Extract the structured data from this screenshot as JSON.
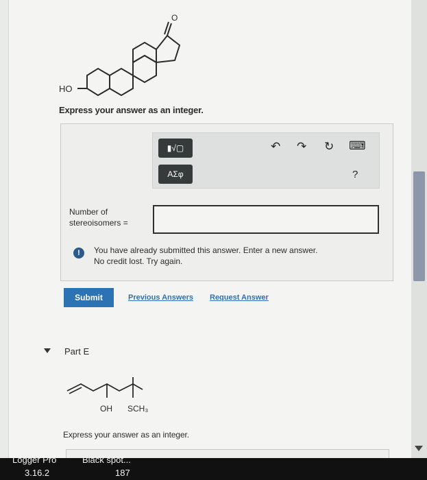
{
  "molecule": {
    "ho_label": "HO",
    "o_label": "O"
  },
  "question": {
    "prompt": "Express your answer as an integer."
  },
  "toolbar": {
    "template_btn": "▮√▢",
    "greek_btn": "ΑΣφ",
    "undo_icon": "↶",
    "redo_icon": "↷",
    "reset_icon": "↻",
    "keyboard_icon": "⌨",
    "help_icon": "?"
  },
  "answer": {
    "label_line1": "Number of",
    "label_line2": "stereoisomers =",
    "value": ""
  },
  "alert": {
    "icon": "!",
    "line1": "You have already submitted this answer. Enter a new answer.",
    "line2": "No credit lost. Try again."
  },
  "actions": {
    "submit": "Submit",
    "previous_answers": "Previous Answers",
    "request_answer": "Request Answer"
  },
  "part_e": {
    "label": "Part E",
    "oh_label": "OH",
    "sch3_label": "SCH₃",
    "prompt": "Express your answer as an integer."
  },
  "taskbar": {
    "item1_top": "Logger Pro",
    "item1_bottom": "3.16.2",
    "item2_top": "Black spot...",
    "item2_bottom": "187"
  }
}
